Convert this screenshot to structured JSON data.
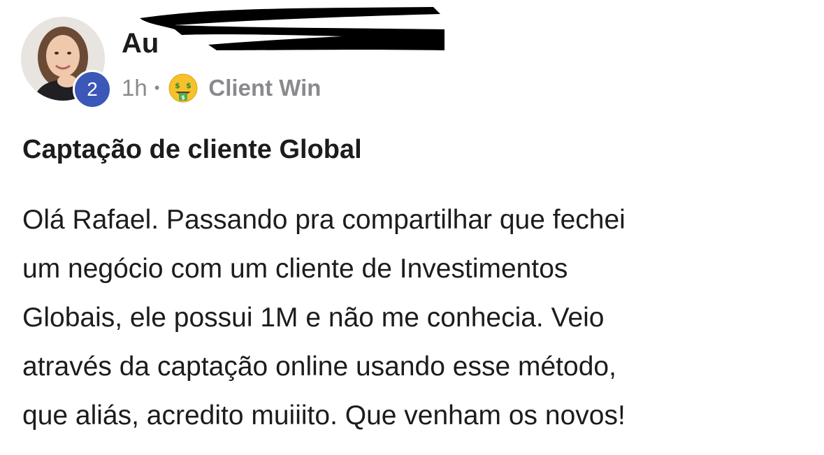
{
  "post": {
    "author": {
      "name_visible": "Au",
      "level": "2"
    },
    "meta": {
      "time": "1h",
      "separator": "•",
      "category_icon": "money-mouth-face-icon",
      "category": "Client Win"
    },
    "title": "Captação de cliente Global",
    "body_lines": [
      "Olá Rafael. Passando pra compartilhar que fechei",
      "um negócio com um cliente de Investimentos",
      "Globais, ele possui 1M e não me conhecia. Veio",
      "através da captação online usando esse método,",
      "que aliás, acredito muiiito. Que venham os novos!"
    ]
  },
  "colors": {
    "badge": "#3b57b8",
    "muted_text": "#8a8a8e",
    "text": "#1c1c1e",
    "redaction": "#000000"
  }
}
